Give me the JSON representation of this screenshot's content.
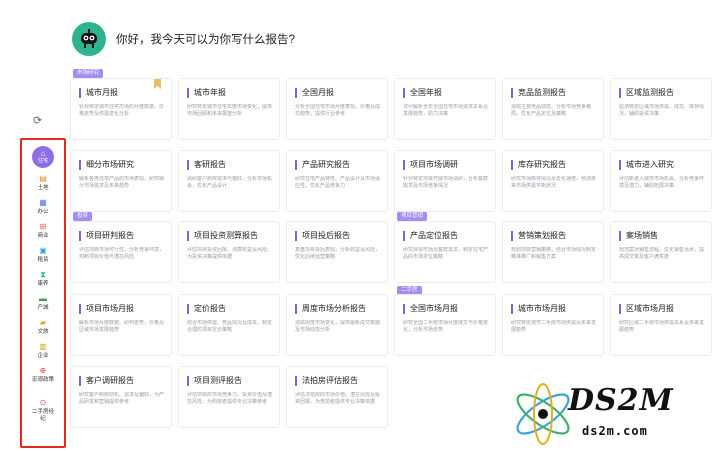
{
  "greeting": {
    "text": "你好，我今天可以为你写什么报告?"
  },
  "rail": {
    "items": [
      {
        "label": "住宅",
        "icon": "home-icon",
        "glyph": "⌂"
      },
      {
        "label": "土地",
        "icon": "land-icon",
        "glyph": "▤"
      },
      {
        "label": "办公",
        "icon": "office-icon",
        "glyph": "▦"
      },
      {
        "label": "商业",
        "icon": "shop-icon",
        "glyph": "⊞"
      },
      {
        "label": "租赁",
        "icon": "lease-icon",
        "glyph": "▣"
      },
      {
        "label": "康养",
        "icon": "wellness-icon",
        "glyph": "⧗"
      },
      {
        "label": "产城",
        "icon": "industry-city-icon",
        "glyph": "▬"
      },
      {
        "label": "文旅",
        "icon": "culture-tourism-icon",
        "glyph": "▰"
      },
      {
        "label": "企业",
        "icon": "enterprise-icon",
        "glyph": "▥"
      },
      {
        "label": "宏观政策",
        "icon": "macro-policy-icon",
        "glyph": "⊕"
      },
      {
        "label": "二手房经纪",
        "icon": "resale-broker-icon",
        "glyph": "⊙"
      }
    ]
  },
  "tags": [
    "市场研究",
    "投资",
    "项目营销",
    "二手房"
  ],
  "cards": [
    {
      "title": "城市月报",
      "desc": "针对特定城市住宅市场的月度数据、价格走势及供需变化分析"
    },
    {
      "title": "城市年报",
      "desc": "研究特定城市住宅年度市场变化，提供市场回顾和未来展望分析"
    },
    {
      "title": "全国月报",
      "desc": "分析全国住宅市场月度表现，价格及成交趋势，提供行业参考"
    },
    {
      "title": "全国年报",
      "desc": "详尽解析全年全国住宅市场需求关系及发展趋势，助力决策"
    },
    {
      "title": "竞品监测报告",
      "desc": "追踪主要竞品动态、分析市场竞争格局，优化产品定位及策略"
    },
    {
      "title": "区域监测报告",
      "desc": "监测特定区域市场供需、成交、库存情况，辅助投资决策"
    },
    {
      "title": "细分市场研究",
      "desc": "解析各类住宅产品的市场表现，研究细分市场需求及未来趋势"
    },
    {
      "title": "客研报告",
      "desc": "调研客户购房需求与偏好，分析市场机会，优化产品设计"
    },
    {
      "title": "产品研究报告",
      "desc": "研究住宅产品特性、产品设计及市场适应性，优化产品竞争力"
    },
    {
      "title": "项目市场调研",
      "desc": "针对特定项目开展市场调研，分析客群需求及市场竞争情况"
    },
    {
      "title": "库存研究报告",
      "desc": "研究市场库存情况及去化速度，预测未来市场供需平衡状况"
    },
    {
      "title": "城市进入研究",
      "desc": "评估新进入城市市场机会，分析竞争环境及潜力，辅助拓展决策"
    },
    {
      "title": "项目研判报告",
      "desc": "评估项目市场可行性，分析竞争环境，判断项目价值与潜在风险"
    },
    {
      "title": "项目投资测算报告",
      "desc": "评估项目投资回报，测算收益及风险，为投资决策提供依据"
    },
    {
      "title": "项目投后报告",
      "desc": "复盘项目投后表现，分析收益及风险，优化后续运营策略"
    },
    {
      "title": "产品定位报告",
      "desc": "研究目标市场及客群需求，制定住宅产品的市场定位策略"
    },
    {
      "title": "营销策划报告",
      "desc": "规划项目营销策略，结合市场情况制定精准推广和销售方案"
    },
    {
      "title": "案场销售",
      "desc": "规范案场销售流程，优化销售话术，提高成交率及客户满意度"
    },
    {
      "title": "项目市场月报",
      "desc": "解析市场月度数据、研判走势、价格及区域市场发展趋势"
    },
    {
      "title": "定价报告",
      "desc": "结合市场供需、竞品情况及成本，制定合理的项目定价策略"
    },
    {
      "title": "周度市场分析报告",
      "desc": "追踪周度市场变化，提供最新成交数据及市场动态分析"
    },
    {
      "title": "全国市场月报",
      "desc": "研究全国二手房市场月度成交与价格变化，分析市场走势"
    },
    {
      "title": "城市市场月报",
      "desc": "研究特定城市二手房市场供需及未来发展趋势"
    },
    {
      "title": "区域市场月报",
      "desc": "研究区域二手房市场供需关系及未来发展趋势"
    },
    {
      "title": "客户调研报告",
      "desc": "研究客户购房动机、需求及偏好，为产品研发和营销提供参考"
    },
    {
      "title": "项目测评报告",
      "desc": "评估项目的市场竞争力、投资价值及潜在风险，为购房者提供专业决策参考"
    },
    {
      "title": "法拍房评估报告",
      "desc": "评估法拍房的市场价值，潜在风险及投资回报，为竞拍者提供专业决策依据"
    }
  ],
  "watermark": {
    "main": "DS2M",
    "sub": "ds2m.com"
  },
  "colors": {
    "accent": "#7b61e8",
    "rail_border": "#e42a1f",
    "avatar": "#2fb38f",
    "tag": "#a58cf0"
  }
}
